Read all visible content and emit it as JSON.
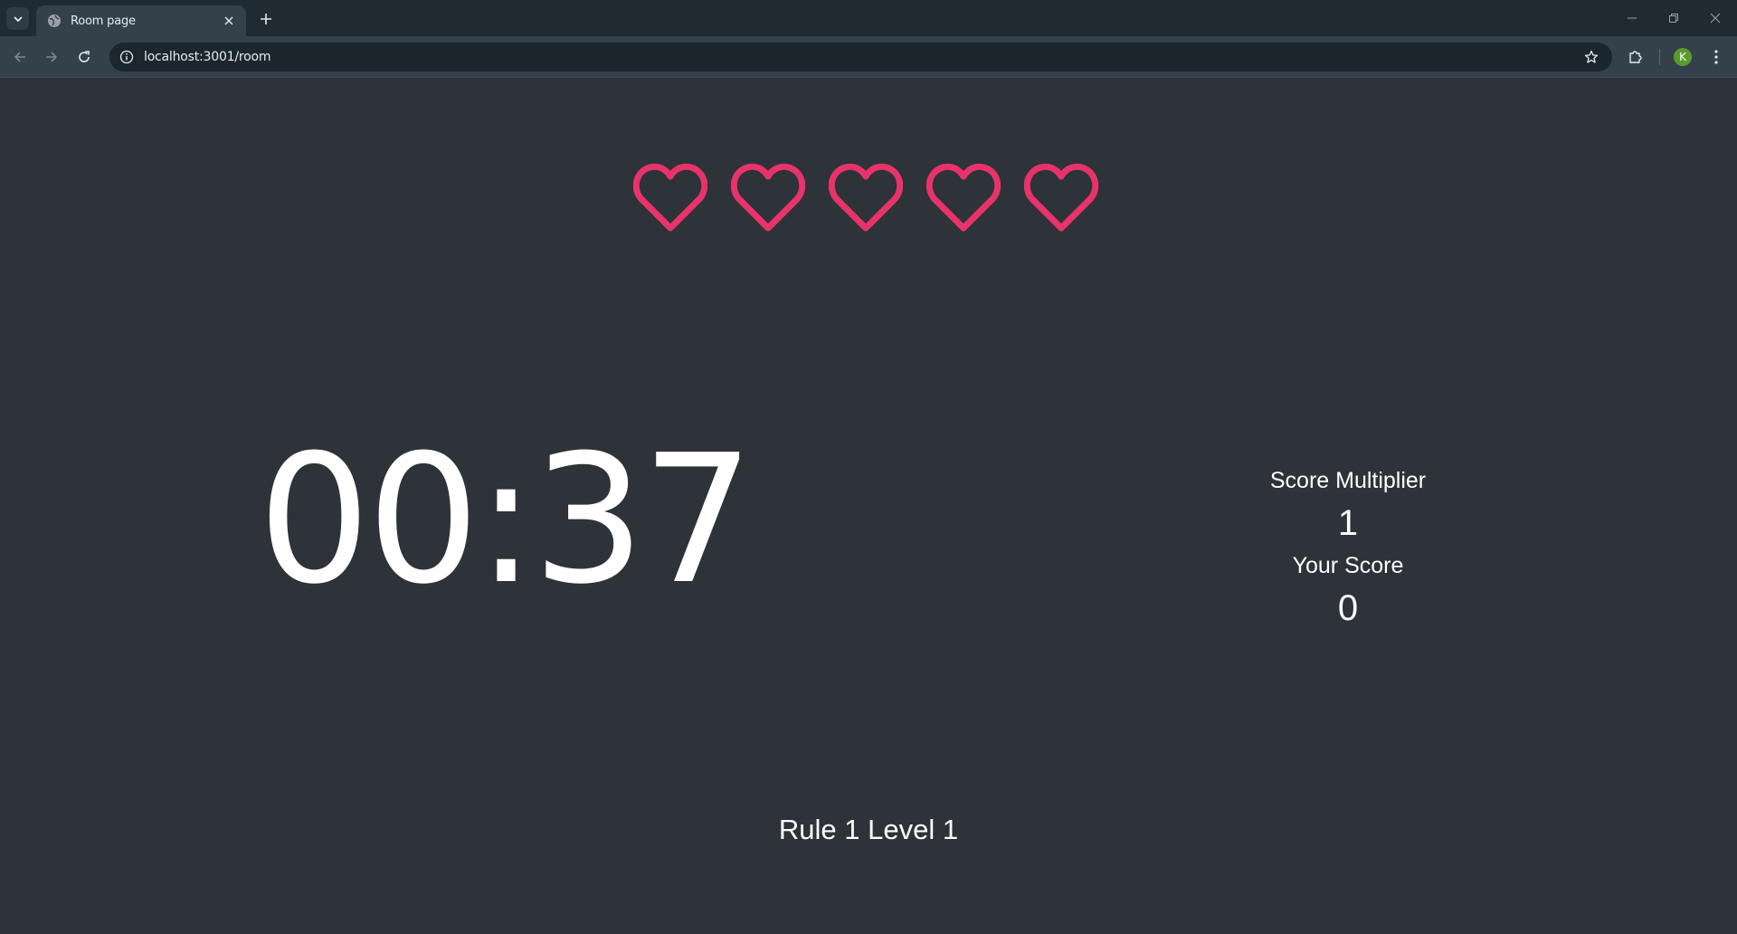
{
  "browser": {
    "tab_title": "Room page",
    "url": "localhost:3001/room",
    "profile_initial": "K",
    "icons": [
      "tab-search-icon",
      "globe-favicon-icon",
      "close-icon",
      "plus-icon",
      "minimize-icon",
      "restore-icon",
      "close-window-icon",
      "back-icon",
      "forward-icon",
      "reload-icon",
      "site-info-icon",
      "star-icon",
      "extensions-icon",
      "more-icon"
    ]
  },
  "game": {
    "lives": 5,
    "heart_color": "#e8336a",
    "timer": "00:37",
    "score_multiplier_label": "Score Multiplier",
    "score_multiplier_value": "1",
    "your_score_label": "Your Score",
    "your_score_value": "0",
    "rule_level": "Rule 1 Level 1"
  },
  "colors": {
    "page_background": "#2d3338",
    "text": "#ffffff"
  }
}
